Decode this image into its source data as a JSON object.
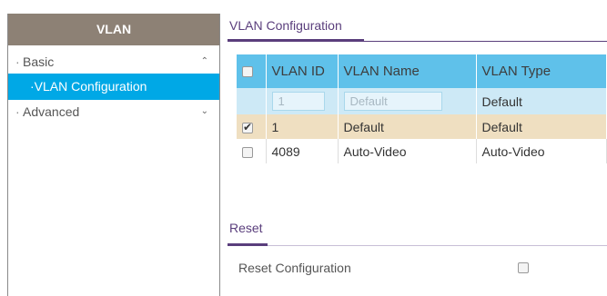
{
  "sidebar": {
    "title": "VLAN",
    "items": [
      {
        "label": "Basic",
        "chevron": "chevron-up-icon"
      },
      {
        "label": "VLAN Configuration"
      },
      {
        "label": "Advanced",
        "chevron": "chevron-down-icon"
      }
    ]
  },
  "main": {
    "section_title": "VLAN Configuration",
    "table": {
      "headers": [
        "VLAN ID",
        "VLAN Name",
        "VLAN Type"
      ],
      "edit_row": {
        "id_placeholder": "1",
        "name_placeholder": "Default",
        "type": "Default"
      },
      "rows": [
        {
          "checked": true,
          "id": "1",
          "name": "Default",
          "type": "Default"
        },
        {
          "checked": false,
          "id": "4089",
          "name": "Auto-Video",
          "type": "Auto-Video"
        }
      ]
    },
    "reset": {
      "title": "Reset",
      "label": "Reset Configuration"
    }
  },
  "colors": {
    "sidebar_header": "#8d8175",
    "accent": "#00a8e6",
    "table_header": "#5fc1ea",
    "selected_row": "#efdfc1",
    "section_title": "#5a3e7c"
  }
}
